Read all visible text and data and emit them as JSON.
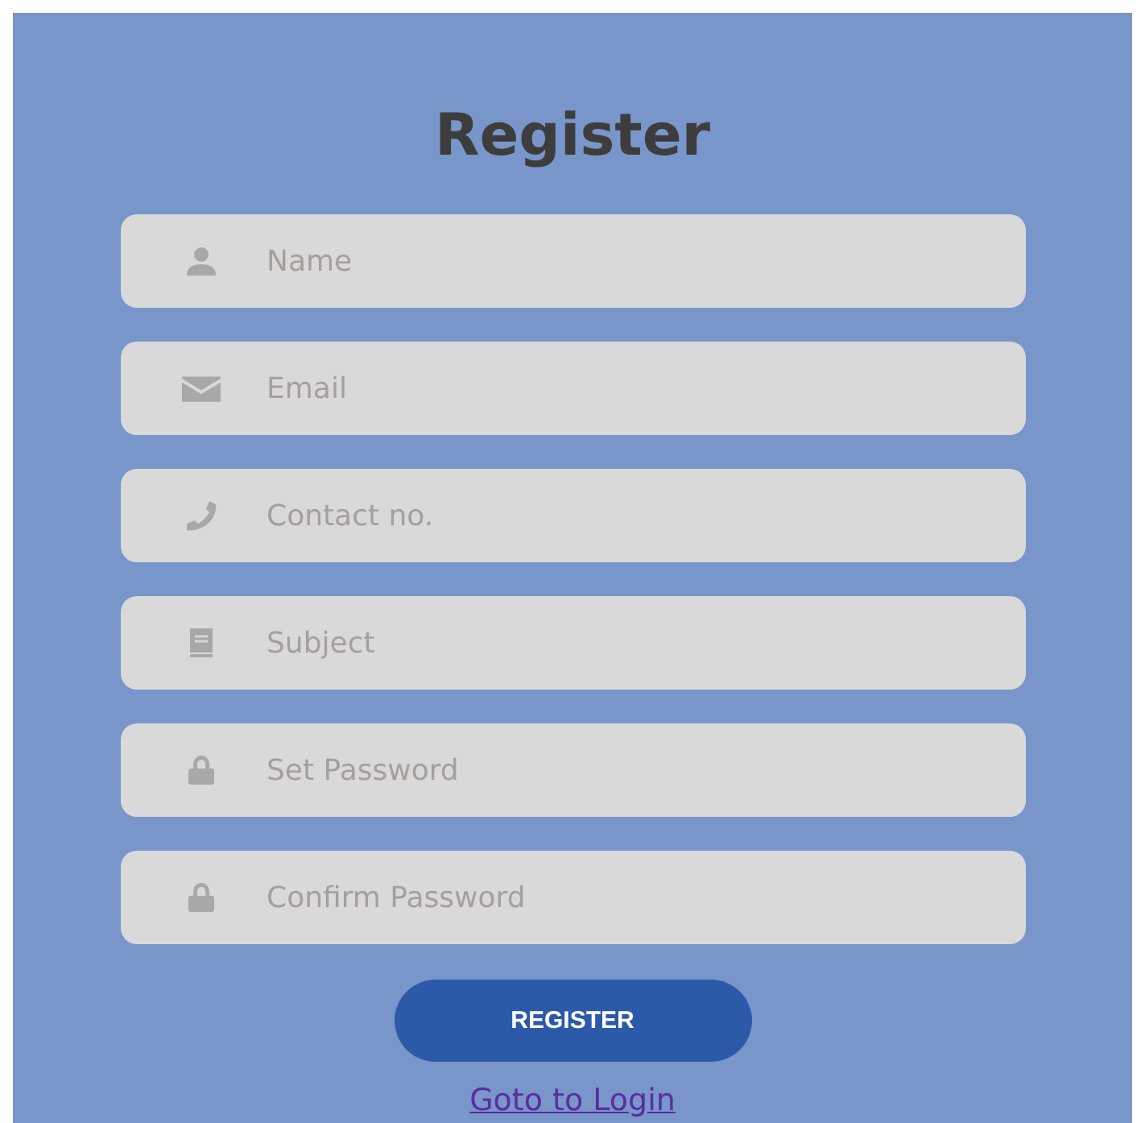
{
  "title": "Register",
  "fields": [
    {
      "kind": "user",
      "placeholder": "Name"
    },
    {
      "kind": "email",
      "placeholder": "Email"
    },
    {
      "kind": "phone",
      "placeholder": "Contact no."
    },
    {
      "kind": "book",
      "placeholder": "Subject"
    },
    {
      "kind": "lock",
      "placeholder": "Set Password"
    },
    {
      "kind": "lock",
      "placeholder": "Confirm Password"
    }
  ],
  "submit": "REGISTER",
  "link": "Goto to Login"
}
